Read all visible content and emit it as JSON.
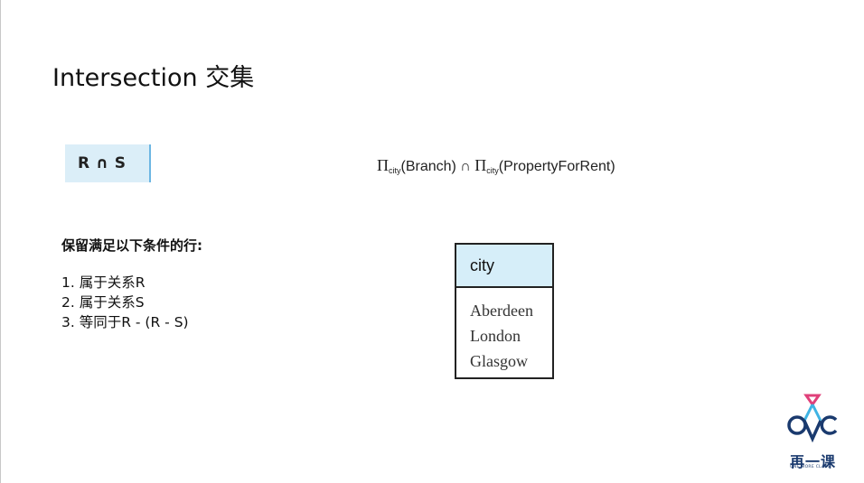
{
  "slide": {
    "title": "Intersection 交集"
  },
  "operation": {
    "notation": "R ∩ S"
  },
  "formula": {
    "pi1": "Π",
    "sub1": "city",
    "rel1": "(Branch)",
    "op": " ∩ ",
    "pi2": "Π",
    "sub2": "city",
    "rel2": "(PropertyForRent)"
  },
  "conditions": {
    "heading": "保留满足以下条件的行:",
    "items": [
      "1. 属于关系R",
      "2. 属于关系S",
      "3. 等同于R - (R - S)"
    ]
  },
  "result_table": {
    "header": "city",
    "rows": [
      "Aberdeen",
      "London",
      "Glasgow"
    ]
  },
  "logo": {
    "cn_text": "再一课",
    "en_text": "ONE MORE CLASS",
    "colors": {
      "navy": "#1a3a6e",
      "pink": "#e0407a",
      "cyan": "#3fb3e3"
    }
  }
}
